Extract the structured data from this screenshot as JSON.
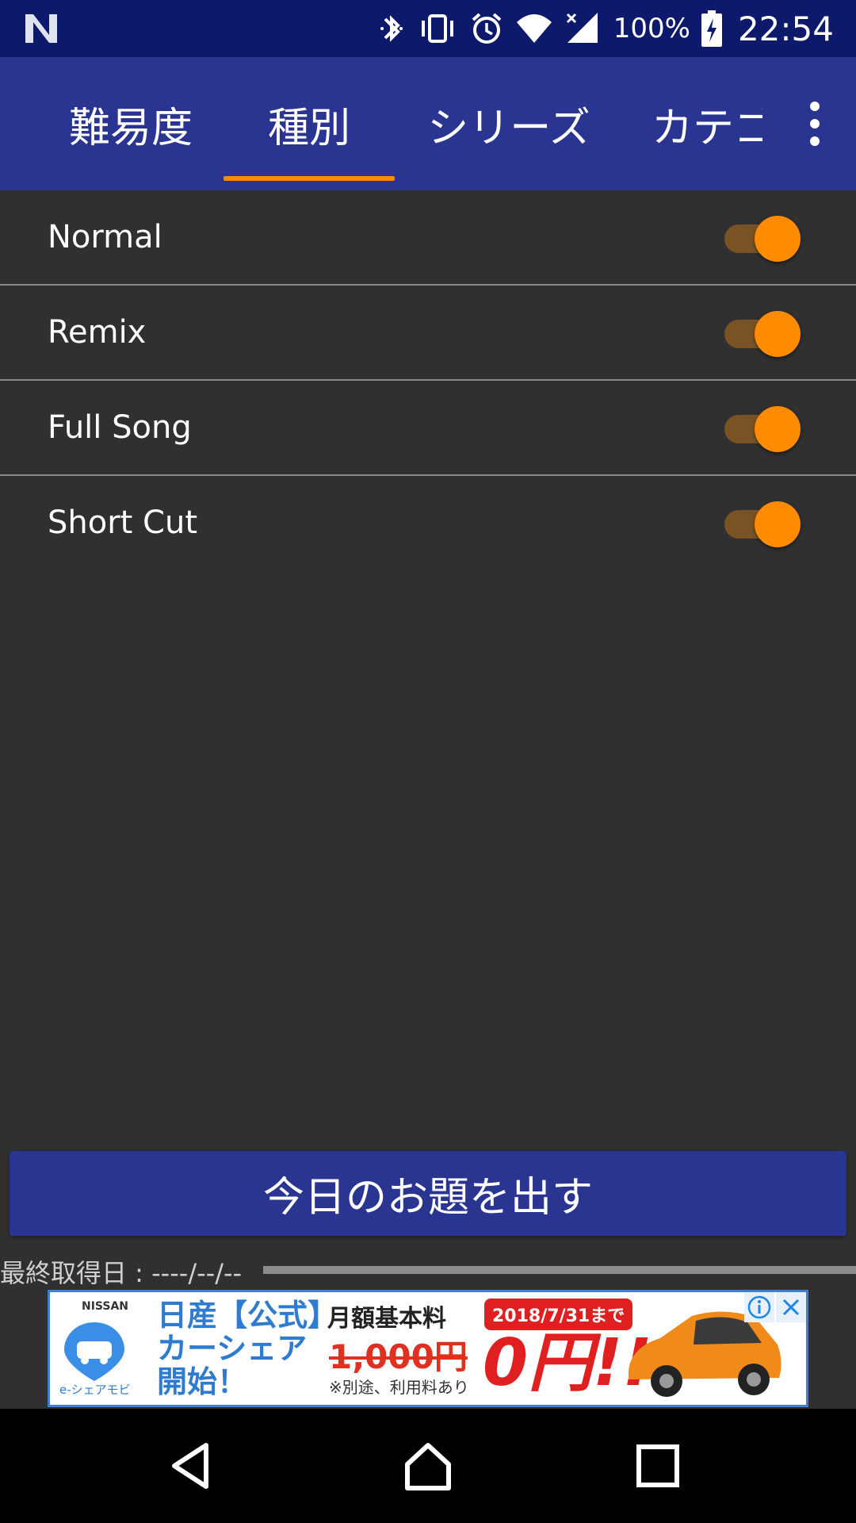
{
  "status_bar": {
    "battery_percent": "100%",
    "time": "22:54",
    "icons": [
      "n-logo-icon",
      "bluetooth-icon",
      "vibrate-icon",
      "alarm-icon",
      "wifi-icon",
      "signal-icon",
      "battery-charging-icon"
    ]
  },
  "tabs": [
    {
      "label": "難易度",
      "selected": false
    },
    {
      "label": "種別",
      "selected": true
    },
    {
      "label": "シリーズ",
      "selected": false
    },
    {
      "label": "カテゴ",
      "selected": false
    }
  ],
  "colors": {
    "status_bar": "#0d1a6b",
    "app_bar": "#2a3592",
    "accent": "#ff8c00",
    "background": "#303030"
  },
  "list_items": [
    {
      "label": "Normal",
      "enabled": true
    },
    {
      "label": "Remix",
      "enabled": true
    },
    {
      "label": "Full Song",
      "enabled": true
    },
    {
      "label": "Short Cut",
      "enabled": true
    }
  ],
  "main_button": {
    "label": "今日のお題を出す"
  },
  "last_fetch": {
    "label": "最終取得日 : ----/--/--",
    "progress": 0
  },
  "ad": {
    "brand": "NISSAN",
    "headline": "日産【公式】\nカーシェア\n開始！",
    "monthly_fee_label": "月額基本料",
    "old_price": "1,000円",
    "note": "※別途、利用料あり",
    "deadline": "2018/7/31まで",
    "new_price": "0円!!",
    "service": "e-シェアモビ"
  }
}
